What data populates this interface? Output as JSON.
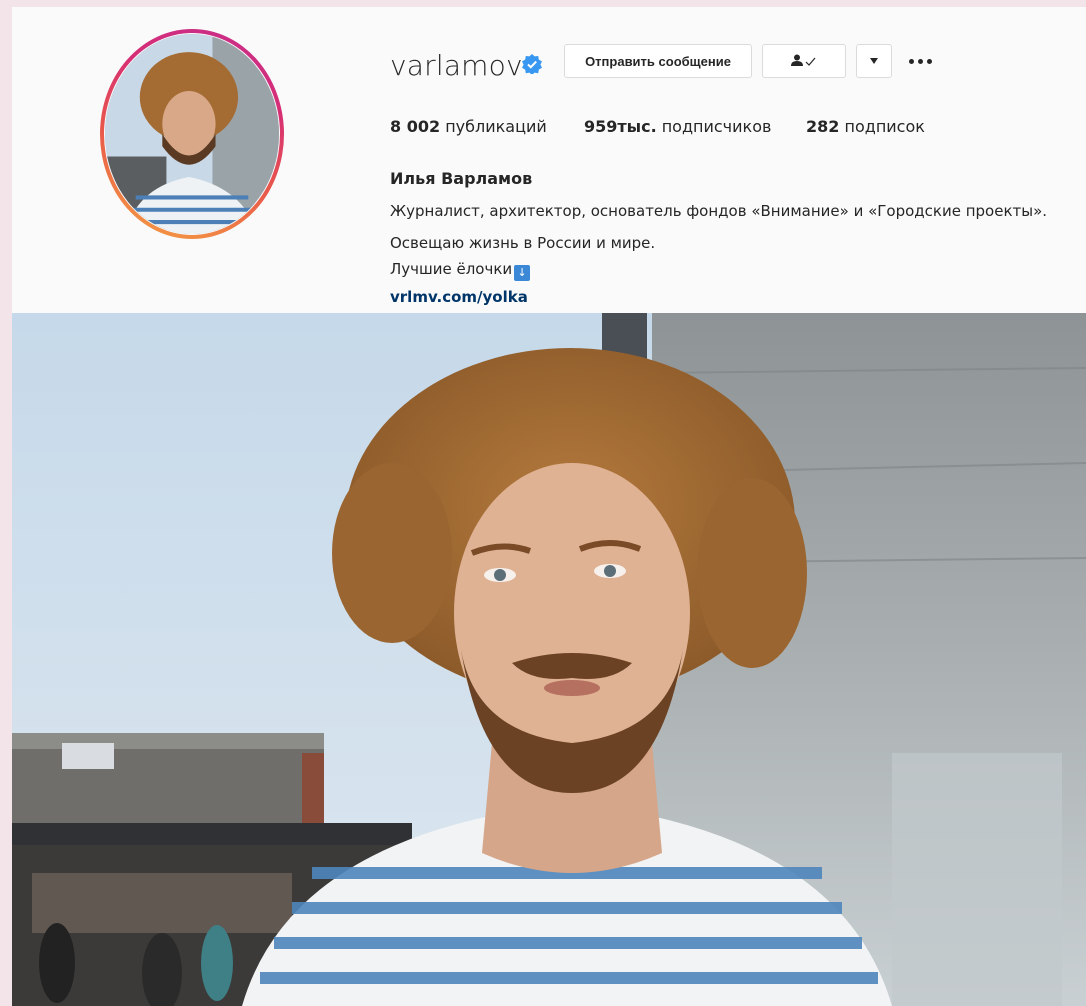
{
  "profile": {
    "username": "varlamov",
    "verified": true,
    "buttons": {
      "message_label": "Отправить сообщение",
      "following_icon": "person-check-icon",
      "dropdown_icon": "triangle-down-icon",
      "more_icon": "more-horizontal-icon"
    },
    "stats": {
      "posts_count": "8 002",
      "posts_label": "публикаций",
      "followers_count": "959тыс.",
      "followers_label": "подписчиков",
      "following_count": "282",
      "following_label": "подписок"
    },
    "full_name": "Илья Варламов",
    "bio": [
      "Журналист, архитектор, основатель фондов «Внимание» и «Городские проекты».",
      "Освещаю жизнь в России и мире.",
      "Лучшие ёлочки"
    ],
    "link": "vrlmv.com/yolka"
  },
  "colors": {
    "background": "#f3e4ea",
    "card": "#fafafa",
    "text": "#262626",
    "link": "#003569",
    "verified_badge": "#3897f0",
    "story_ring_start": "#f5a341",
    "story_ring_end": "#c72d8c"
  }
}
